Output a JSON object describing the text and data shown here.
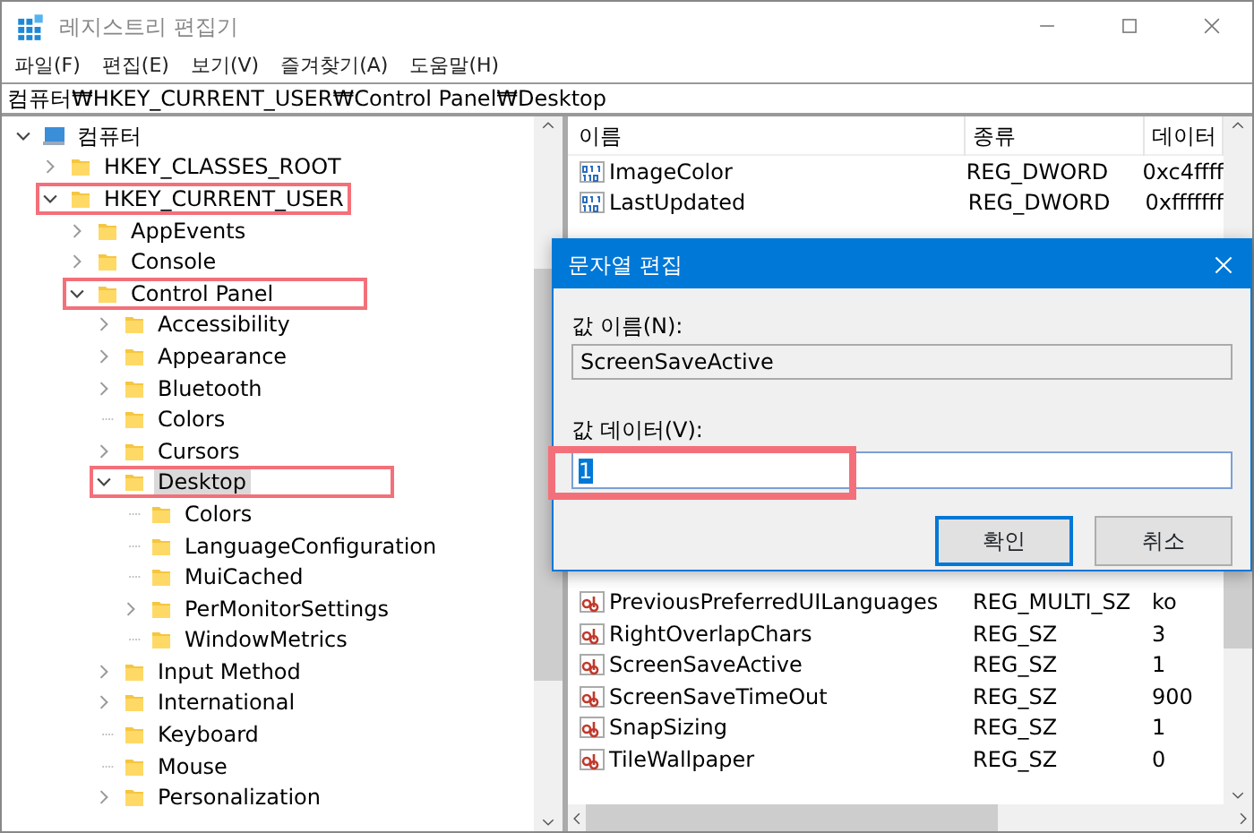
{
  "window": {
    "title": "레지스트리 편집기",
    "active": false
  },
  "menu": [
    "파일(F)",
    "편집(E)",
    "보기(V)",
    "즐겨찾기(A)",
    "도움말(H)"
  ],
  "address": "컴퓨터₩HKEY_CURRENT_USER₩Control Panel₩Desktop",
  "tree": [
    {
      "label": "컴퓨터",
      "kind": "computer",
      "has_children": true,
      "expanded": true,
      "selected": false,
      "highlighted": false,
      "children": [
        {
          "label": "HKEY_CLASSES_ROOT",
          "kind": "folder",
          "has_children": true,
          "expanded": false,
          "selected": false,
          "highlighted": false
        },
        {
          "label": "HKEY_CURRENT_USER",
          "kind": "folder",
          "has_children": true,
          "expanded": true,
          "selected": false,
          "highlighted": true,
          "children": [
            {
              "label": "AppEvents",
              "kind": "folder",
              "has_children": true,
              "expanded": false,
              "selected": false,
              "highlighted": false
            },
            {
              "label": "Console",
              "kind": "folder",
              "has_children": true,
              "expanded": false,
              "selected": false,
              "highlighted": false
            },
            {
              "label": "Control Panel",
              "kind": "folder",
              "has_children": true,
              "expanded": true,
              "selected": false,
              "highlighted": true,
              "children": [
                {
                  "label": "Accessibility",
                  "kind": "folder",
                  "has_children": true,
                  "expanded": false,
                  "selected": false,
                  "highlighted": false
                },
                {
                  "label": "Appearance",
                  "kind": "folder",
                  "has_children": true,
                  "expanded": false,
                  "selected": false,
                  "highlighted": false
                },
                {
                  "label": "Bluetooth",
                  "kind": "folder",
                  "has_children": true,
                  "expanded": false,
                  "selected": false,
                  "highlighted": false
                },
                {
                  "label": "Colors",
                  "kind": "folder",
                  "has_children": false,
                  "selected": false,
                  "highlighted": false
                },
                {
                  "label": "Cursors",
                  "kind": "folder",
                  "has_children": true,
                  "expanded": false,
                  "selected": false,
                  "highlighted": false
                },
                {
                  "label": "Desktop",
                  "kind": "folder",
                  "has_children": true,
                  "expanded": true,
                  "selected": true,
                  "highlighted": true,
                  "children": [
                    {
                      "label": "Colors",
                      "kind": "folder",
                      "has_children": false,
                      "selected": false,
                      "highlighted": false
                    },
                    {
                      "label": "LanguageConfiguration",
                      "kind": "folder",
                      "has_children": false,
                      "selected": false,
                      "highlighted": false
                    },
                    {
                      "label": "MuiCached",
                      "kind": "folder",
                      "has_children": false,
                      "selected": false,
                      "highlighted": false
                    },
                    {
                      "label": "PerMonitorSettings",
                      "kind": "folder",
                      "has_children": true,
                      "expanded": false,
                      "selected": false,
                      "highlighted": false
                    },
                    {
                      "label": "WindowMetrics",
                      "kind": "folder",
                      "has_children": false,
                      "selected": false,
                      "highlighted": false
                    }
                  ]
                },
                {
                  "label": "Input Method",
                  "kind": "folder",
                  "has_children": true,
                  "expanded": false,
                  "selected": false,
                  "highlighted": false
                },
                {
                  "label": "International",
                  "kind": "folder",
                  "has_children": true,
                  "expanded": false,
                  "selected": false,
                  "highlighted": false
                },
                {
                  "label": "Keyboard",
                  "kind": "folder",
                  "has_children": false,
                  "selected": false,
                  "highlighted": false
                },
                {
                  "label": "Mouse",
                  "kind": "folder",
                  "has_children": false,
                  "selected": false,
                  "highlighted": false
                },
                {
                  "label": "Personalization",
                  "kind": "folder",
                  "has_children": true,
                  "expanded": false,
                  "selected": false,
                  "highlighted": false
                }
              ]
            }
          ]
        }
      ]
    }
  ],
  "values": {
    "columns": [
      "이름",
      "종류",
      "데이터"
    ],
    "rows_top": [
      {
        "name": "ImageColor",
        "type": "REG_DWORD",
        "data": "0xc4ffff",
        "kind": "binary"
      },
      {
        "name": "LastUpdated",
        "type": "REG_DWORD",
        "data": "0xfffffff",
        "kind": "binary"
      }
    ],
    "rows_bottom": [
      {
        "name": "PreviousPreferredUILanguages",
        "type": "REG_MULTI_SZ",
        "data": "ko",
        "kind": "string"
      },
      {
        "name": "RightOverlapChars",
        "type": "REG_SZ",
        "data": "3",
        "kind": "string"
      },
      {
        "name": "ScreenSaveActive",
        "type": "REG_SZ",
        "data": "1",
        "kind": "string"
      },
      {
        "name": "ScreenSaveTimeOut",
        "type": "REG_SZ",
        "data": "900",
        "kind": "string"
      },
      {
        "name": "SnapSizing",
        "type": "REG_SZ",
        "data": "1",
        "kind": "string"
      },
      {
        "name": "TileWallpaper",
        "type": "REG_SZ",
        "data": "0",
        "kind": "string"
      }
    ]
  },
  "dialog": {
    "title": "문자열 편집",
    "name_label": "값 이름(N):",
    "name_value": "ScreenSaveActive",
    "data_label": "값 데이터(V):",
    "data_value": "1",
    "data_highlighted": true,
    "buttons": [
      {
        "label": "확인",
        "default": true
      },
      {
        "label": "취소",
        "default": false
      }
    ]
  }
}
